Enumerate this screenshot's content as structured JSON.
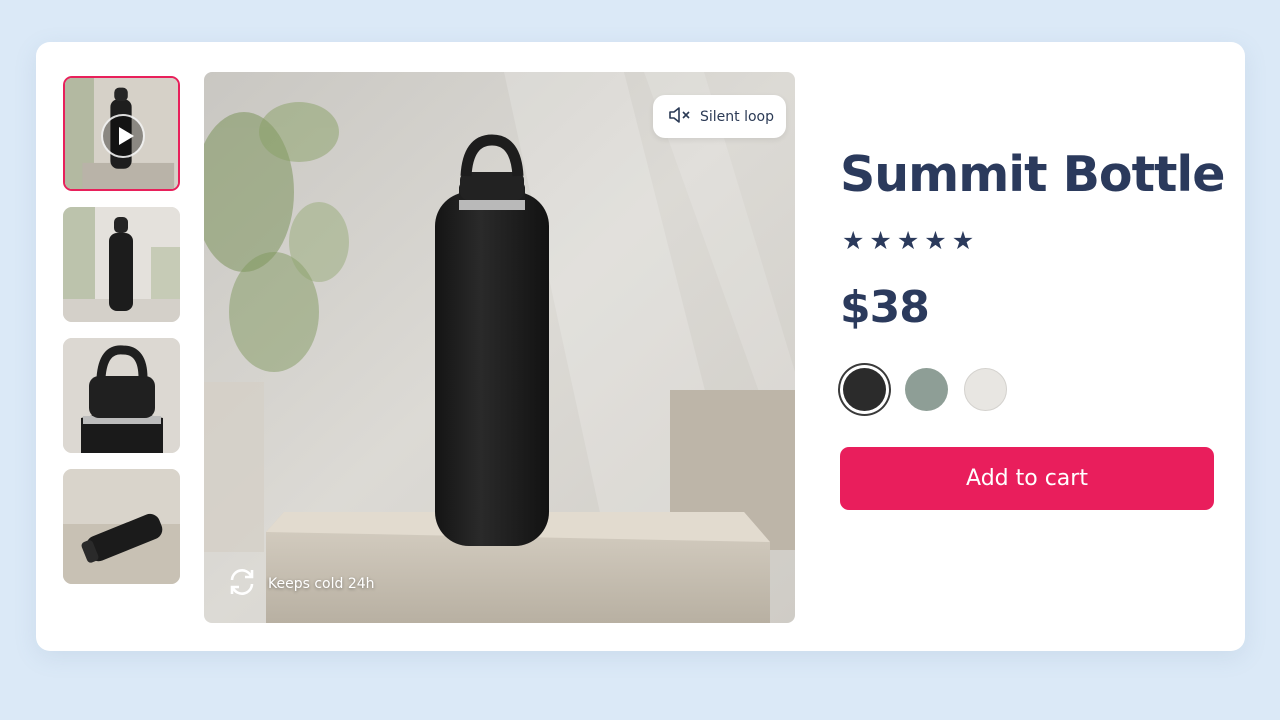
{
  "product": {
    "title": "Summit Bottle",
    "rating": 5,
    "price": "$38",
    "add_to_cart_label": "Add to cart"
  },
  "media": {
    "sound_chip_label": "Silent loop",
    "feature_label": "Keeps cold 24h",
    "thumbnails": [
      {
        "kind": "video",
        "selected": true
      },
      {
        "kind": "image",
        "selected": false
      },
      {
        "kind": "image",
        "selected": false
      },
      {
        "kind": "image",
        "selected": false
      }
    ]
  },
  "swatches": [
    {
      "color": "#2b2b2b",
      "selected": true
    },
    {
      "color": "#8e9e96",
      "selected": false
    },
    {
      "color": "#e8e6e2",
      "selected": false
    }
  ],
  "icons": [
    "play-icon",
    "mute-icon",
    "refresh-icon",
    "star-icon"
  ],
  "colors": {
    "accent": "#e91e5c",
    "text": "#2b3a5c",
    "background": "#dbe9f7"
  }
}
